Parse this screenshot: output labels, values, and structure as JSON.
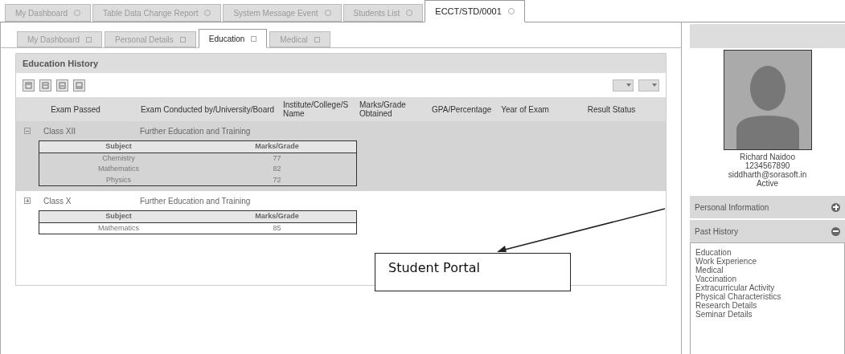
{
  "top_tabs": [
    {
      "label": "My Dashboard",
      "selected": false
    },
    {
      "label": "Table Data Change Report",
      "selected": false
    },
    {
      "label": "System Message Event",
      "selected": false
    },
    {
      "label": "Students List",
      "selected": false
    },
    {
      "label": "ECCT/STD/0001",
      "selected": true
    }
  ],
  "sub_tabs": [
    {
      "label": "My Dashboard",
      "selected": false
    },
    {
      "label": "Personal Details",
      "selected": false
    },
    {
      "label": "Education",
      "selected": true
    },
    {
      "label": "Medical",
      "selected": false
    }
  ],
  "panel": {
    "title": "Education History"
  },
  "table": {
    "columns": [
      "Exam Passed",
      "Exam Conducted by/University/Board",
      "Institute/College/S Name",
      "Marks/Grade Obtained",
      "GPA/Percentage",
      "Year of Exam",
      "Result Status"
    ],
    "rows": [
      {
        "exam": "Class XII",
        "board": "Further Education and Training",
        "expanded": true,
        "selected": true,
        "sub_columns": [
          "Subject",
          "Marks/Grade"
        ],
        "sub_rows": [
          [
            "Chemistry",
            "77"
          ],
          [
            "Mathematics",
            "82"
          ],
          [
            "Physics",
            "72"
          ]
        ]
      },
      {
        "exam": "Class X",
        "board": "Further Education and Training",
        "expanded": false,
        "selected": false,
        "sub_columns": [
          "Subject",
          "Marks/Grade"
        ],
        "sub_rows": [
          [
            "Mathematics",
            "85"
          ]
        ]
      }
    ]
  },
  "callout": {
    "text": "Student Portal"
  },
  "profile": {
    "name": "Richard Naidoo",
    "phone": "1234567890",
    "email": "siddharth@sorasoft.in",
    "status": "Active"
  },
  "accordion": [
    {
      "title": "Personal Information",
      "expanded": false
    },
    {
      "title": "Past History",
      "expanded": true,
      "items": [
        "Education",
        "Work Experience",
        "Medical",
        "Vaccination",
        "Extracurricular Activity",
        "Physical Characteristics",
        "Research Details",
        "Seminar Details"
      ]
    }
  ]
}
